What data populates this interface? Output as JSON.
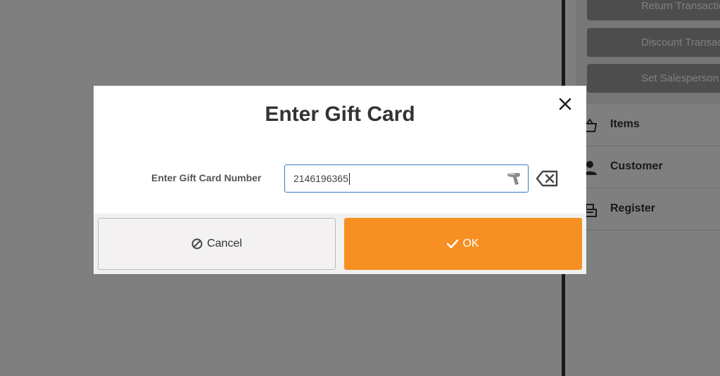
{
  "background": {
    "actions": [
      "Return Transaction",
      "Discount Transaction",
      "Set Salesperson"
    ],
    "nav": [
      {
        "label": "Items",
        "icon": "basket-icon"
      },
      {
        "label": "Customer",
        "icon": "person-icon"
      },
      {
        "label": "Register",
        "icon": "register-icon"
      }
    ]
  },
  "dialog": {
    "title": "Enter Gift Card",
    "field_label": "Enter Gift Card Number",
    "field_value": "2146196365",
    "cancel_label": "Cancel",
    "ok_label": "OK",
    "accent_color": "#f69022",
    "icons": {
      "close": "close-icon",
      "scanner": "barcode-scanner-icon",
      "clear": "clear-input-icon",
      "cancel": "cancel-icon",
      "ok": "check-icon"
    }
  }
}
